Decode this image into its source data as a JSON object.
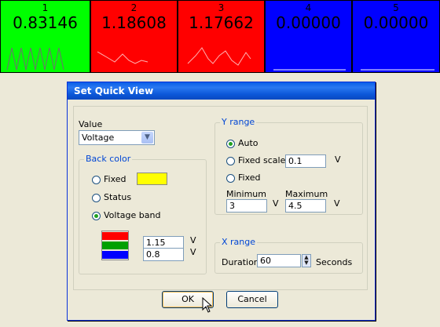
{
  "quick_view": {
    "panels": [
      {
        "num": "1",
        "value": "0.83146",
        "bg": "#00ff00",
        "fg": "#000000",
        "line": "#6f6f6f"
      },
      {
        "num": "2",
        "value": "1.18608",
        "bg": "#ff0000",
        "fg": "#000000",
        "line": "#ffb3b3"
      },
      {
        "num": "3",
        "value": "1.17662",
        "bg": "#ff0000",
        "fg": "#000000",
        "line": "#ffb3b3"
      },
      {
        "num": "4",
        "value": "0.00000",
        "bg": "#0000ff",
        "fg": "#000000",
        "line": "#ffffff"
      },
      {
        "num": "5",
        "value": "0.00000",
        "bg": "#0000ff",
        "fg": "#000000",
        "line": "#ffffff"
      }
    ]
  },
  "dialog": {
    "title": "Set Quick View",
    "value_label": "Value",
    "value_selected": "Voltage",
    "back_color": {
      "title": "Back color",
      "fixed_label": "Fixed",
      "fixed_color": "#ffff00",
      "status_label": "Status",
      "voltage_band_label": "Voltage band",
      "selected": "Voltage band",
      "band_colors": [
        "#ff0000",
        "#00a000",
        "#0000ff"
      ],
      "upper": "1.15",
      "lower": "0.8",
      "unit": "V"
    },
    "y_range": {
      "title": "Y range",
      "auto_label": "Auto",
      "fixed_scale_label": "Fixed scale",
      "fixed_scale_value": "0.1",
      "fixed_label": "Fixed",
      "unit": "V",
      "selected": "Auto",
      "minimum_label": "Minimum",
      "maximum_label": "Maximum",
      "minimum": "3",
      "maximum": "4.5"
    },
    "x_range": {
      "title": "X range",
      "duration_label": "Duration",
      "duration": "60",
      "unit": "Seconds"
    },
    "ok_label": "OK",
    "cancel_label": "Cancel"
  }
}
